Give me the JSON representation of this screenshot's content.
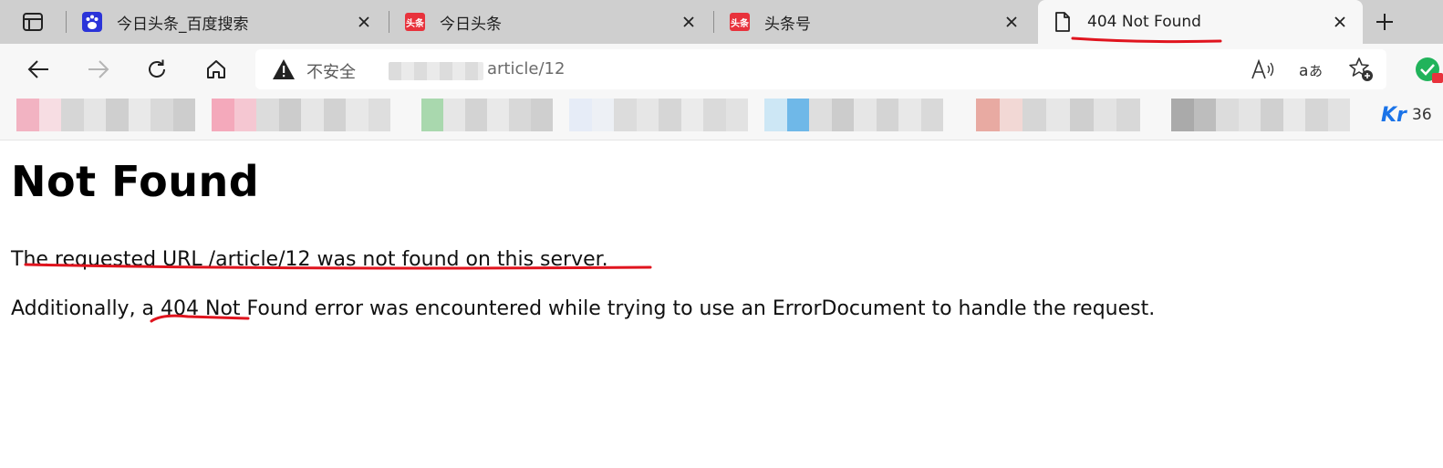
{
  "tabs": [
    {
      "title": "今日头条_百度搜索",
      "favicon": "baidu-favicon",
      "active": false
    },
    {
      "title": "今日头条",
      "favicon": "toutiao-favicon",
      "favicon_text": "头条",
      "active": false
    },
    {
      "title": "头条号",
      "favicon": "toutiao-favicon",
      "favicon_text": "头条",
      "active": false
    },
    {
      "title": "404 Not Found",
      "favicon": "page-icon",
      "active": true
    }
  ],
  "address_bar": {
    "security_label": "不安全",
    "url_visible": "article/12"
  },
  "favorites_bar": {
    "overflow_text": "36"
  },
  "page": {
    "heading": "Not Found",
    "paragraph1": "The requested URL /article/12 was not found on this server.",
    "paragraph2": "Additionally, a 404 Not Found error was encountered while trying to use an ErrorDocument to handle the request."
  },
  "colors": {
    "annotation": "#e0141e",
    "baidu_blue": "#2b34d9",
    "toutiao_red": "#e8323c"
  }
}
